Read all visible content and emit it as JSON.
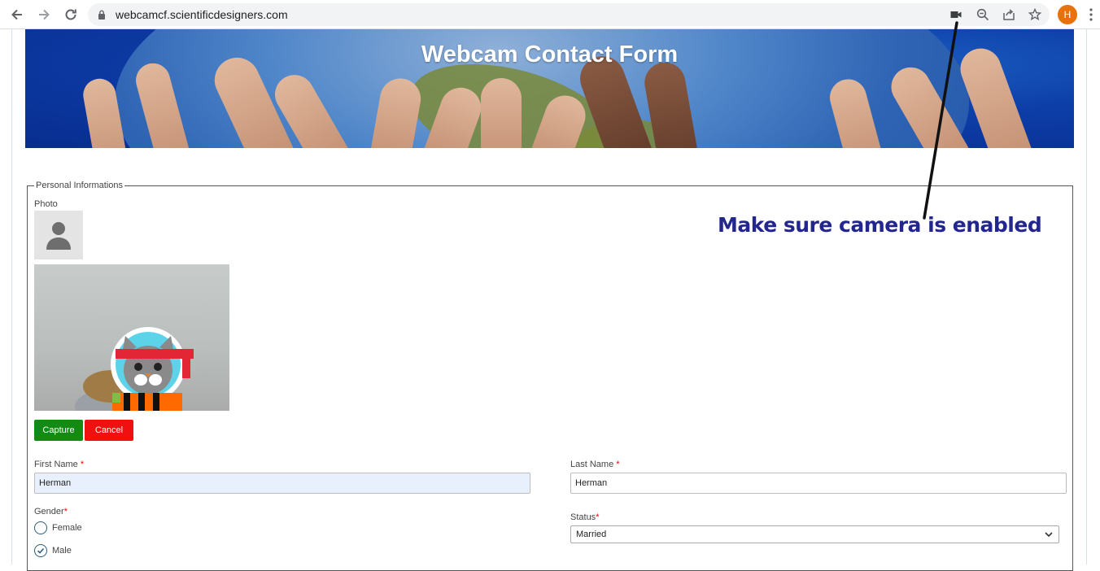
{
  "browser": {
    "url": "webcamcf.scientificdesigners.com",
    "avatar_initial": "H",
    "accent": "#e8710a"
  },
  "header": {
    "title": "Webcam Contact Form"
  },
  "form": {
    "legend": "Personal Informations",
    "photo_label": "Photo",
    "capture_label": "Capture",
    "cancel_label": "Cancel",
    "first_name": {
      "label": "First Name",
      "required_mark": "*",
      "value": "Herman"
    },
    "last_name": {
      "label": "Last Name",
      "required_mark": "*",
      "value": "Herman"
    },
    "gender": {
      "label": "Gender",
      "required_mark": "*",
      "options": [
        {
          "label": "Female",
          "checked": false
        },
        {
          "label": "Male",
          "checked": true
        }
      ]
    },
    "status": {
      "label": "Status",
      "required_mark": "*",
      "selected": "Married"
    }
  },
  "annotation": {
    "text": "Make sure camera is enabled",
    "color": "#23268d"
  }
}
